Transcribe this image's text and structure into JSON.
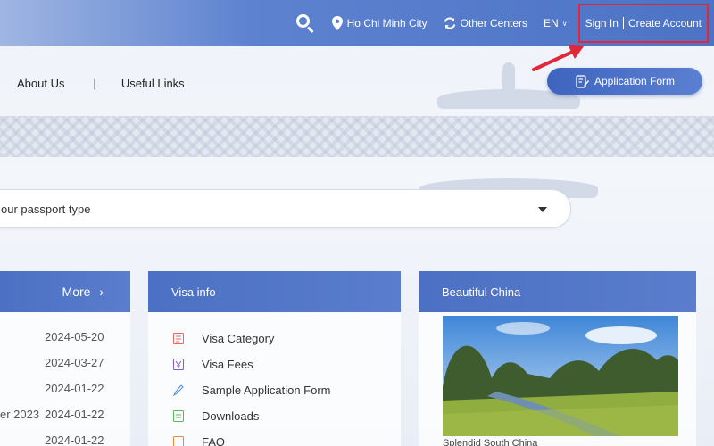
{
  "topbar": {
    "city": "Ho Chi Minh City",
    "other_centers": "Other Centers",
    "language": "EN",
    "sign_in": "Sign In",
    "create_account": "Create Account"
  },
  "nav": {
    "about": "About Us",
    "separator": "|",
    "useful_links": "Useful Links"
  },
  "application_form_button": "Application Form",
  "passport_select": {
    "value": "our passport type"
  },
  "news": {
    "more_label": "More",
    "more_chevron": "›",
    "items": [
      {
        "prefix": "",
        "date": "2024-05-20"
      },
      {
        "prefix": "",
        "date": "2024-03-27"
      },
      {
        "prefix": "",
        "date": "2024-01-22"
      },
      {
        "prefix": "er 2023",
        "date": "2024-01-22"
      },
      {
        "prefix": "",
        "date": "2024-01-22"
      }
    ]
  },
  "visa_info": {
    "title": "Visa info",
    "items": [
      {
        "label": "Visa Category",
        "icon": "category-icon",
        "color": "#e36a5a"
      },
      {
        "label": "Visa Fees",
        "icon": "yen-fee-icon",
        "color": "#8a5bbf"
      },
      {
        "label": "Sample Application Form",
        "icon": "pen-icon",
        "color": "#4a8fd6"
      },
      {
        "label": "Downloads",
        "icon": "download-doc-icon",
        "color": "#5cb85c"
      },
      {
        "label": "FAQ",
        "icon": "faq-icon",
        "color": "#e38a3a"
      }
    ]
  },
  "beautiful_china": {
    "title": "Beautiful China",
    "caption": "Splendid South China"
  },
  "colors": {
    "header_blue": "#4d73c6",
    "card_header": "#4c70c3",
    "annotation_red": "#e0283a"
  }
}
